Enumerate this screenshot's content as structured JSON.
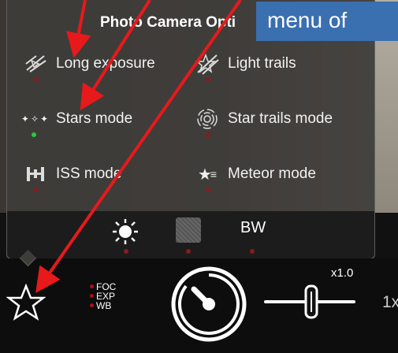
{
  "panel": {
    "title": "Photo Camera Opti",
    "options": [
      {
        "label": "Long exposure",
        "icon": "long-exposure-icon",
        "active": false
      },
      {
        "label": "Light trails",
        "icon": "light-trails-icon",
        "active": false
      },
      {
        "label": "Stars mode",
        "icon": "stars-icon",
        "active": true
      },
      {
        "label": "Star trails mode",
        "icon": "star-trails-icon",
        "active": false
      },
      {
        "label": "ISS mode",
        "icon": "iss-icon",
        "active": false
      },
      {
        "label": "Meteor mode",
        "icon": "meteor-icon",
        "active": false
      }
    ],
    "quick": {
      "bw_label": "BW"
    }
  },
  "bottom": {
    "flags": [
      "FOC",
      "EXP",
      "WB"
    ],
    "zoom_label": "x1.0",
    "zoom_right": "1x"
  },
  "callout": {
    "text": "menu of"
  },
  "colors": {
    "callout": "#3a6fb0",
    "arrow": "#e8191b",
    "active_dot": "#27c93f",
    "inactive_dot": "#8a1b1b"
  }
}
